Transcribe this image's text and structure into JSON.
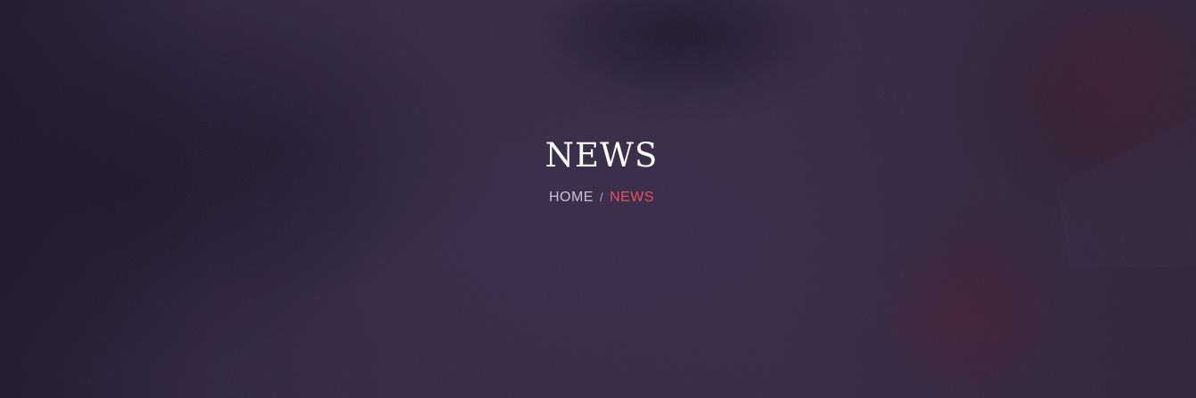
{
  "hero": {
    "title": "NEWS",
    "breadcrumb": {
      "home_label": "HOME",
      "separator": "/",
      "current_label": "NEWS"
    }
  },
  "colors": {
    "background": "#35293f",
    "title": "#ffffff",
    "breadcrumb_link": "#c9c3d2",
    "breadcrumb_current": "#e8515a"
  }
}
